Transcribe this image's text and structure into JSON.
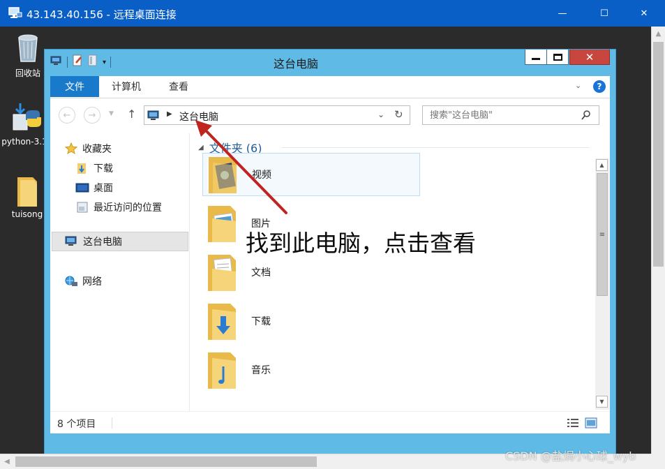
{
  "rdp": {
    "title": "43.143.40.156 - 远程桌面连接",
    "minimize_glyph": "—",
    "maximize_glyph": "☐",
    "close_glyph": "✕"
  },
  "desktop": {
    "icons": [
      {
        "label": "回收站",
        "icon": "recycle-bin-icon"
      },
      {
        "label": "python-3.1",
        "icon": "python-installer-icon"
      },
      {
        "label": "tuisong",
        "icon": "folder-icon"
      }
    ]
  },
  "explorer": {
    "title": "这台电脑",
    "ribbon": {
      "file_tab": "文件",
      "computer_tab": "计算机",
      "view_tab": "查看",
      "help_glyph": "?"
    },
    "address": {
      "path": "这台电脑"
    },
    "search": {
      "placeholder": "搜索\"这台电脑\""
    },
    "nav_pane": {
      "favorites": "收藏夹",
      "downloads": "下载",
      "desktop": "桌面",
      "recent": "最近访问的位置",
      "this_pc": "这台电脑",
      "network": "网络"
    },
    "files": {
      "group_header": "文件夹 (6)",
      "folders": [
        {
          "name": "视频",
          "icon": "videos-folder-icon"
        },
        {
          "name": "图片",
          "icon": "pictures-folder-icon"
        },
        {
          "name": "文档",
          "icon": "documents-folder-icon"
        },
        {
          "name": "下载",
          "icon": "downloads-folder-icon"
        },
        {
          "name": "音乐",
          "icon": "music-folder-icon"
        }
      ]
    },
    "status": {
      "item_count": "8 个项目"
    }
  },
  "annotation": {
    "text": "找到此电脑，点击查看",
    "arrow_color": "#c0241f"
  },
  "watermark": "CSDN @盐焗小心球_wyb",
  "colors": {
    "rdp_titlebar": "#0a5fc6",
    "explorer_frame": "#5fbbe6",
    "file_tab": "#1979ca",
    "close_button": "#c8463d"
  }
}
